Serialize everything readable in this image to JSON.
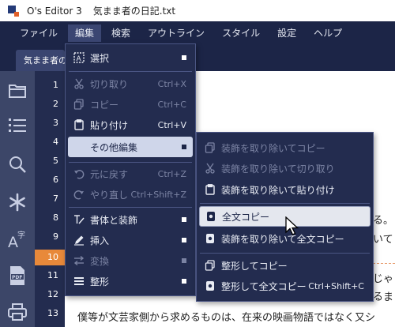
{
  "window": {
    "app_title": "O's Editor 3",
    "doc_title": "気まま者の日記.txt"
  },
  "menubar": [
    "ファイル",
    "編集",
    "検索",
    "アウトライン",
    "スタイル",
    "設定",
    "ヘルプ"
  ],
  "tab": {
    "label": "気まま者の日記.txt"
  },
  "sidebar_icons": [
    "folder-icon",
    "list-icon",
    "search-icon",
    "asterisk-icon",
    "text-size-icon",
    "pdf-icon",
    "print-icon"
  ],
  "gutter": {
    "line_numbers": [
      "1",
      "2",
      "3",
      "4",
      "5",
      "6",
      "7",
      "8",
      "9",
      "10",
      "11",
      "12",
      "13"
    ],
    "current_line": "10"
  },
  "editor": {
    "fragments": [
      "る。",
      "いて",
      "じゃ",
      "るま",
      "僕等が文芸家側から求めるものは、在来の映画物語ではなく又シ"
    ]
  },
  "edit_menu": {
    "items": [
      {
        "icon": "select-icon",
        "label": "選択",
        "shortcut": "",
        "submenu": true,
        "disabled": false
      },
      {
        "icon": "cut-icon",
        "label": "切り取り",
        "shortcut": "Ctrl+X",
        "submenu": false,
        "disabled": true
      },
      {
        "icon": "copy-icon",
        "label": "コピー",
        "shortcut": "Ctrl+C",
        "submenu": false,
        "disabled": true
      },
      {
        "icon": "paste-icon",
        "label": "貼り付け",
        "shortcut": "Ctrl+V",
        "submenu": false,
        "disabled": false
      },
      {
        "icon": "",
        "label": "その他編集",
        "shortcut": "",
        "submenu": true,
        "disabled": false
      },
      {
        "icon": "undo-icon",
        "label": "元に戻す",
        "shortcut": "Ctrl+Z",
        "submenu": false,
        "disabled": true
      },
      {
        "icon": "redo-icon",
        "label": "やり直し",
        "shortcut": "Ctrl+Shift+Z",
        "submenu": false,
        "disabled": true
      },
      {
        "icon": "format-icon",
        "label": "書体と装飾",
        "shortcut": "",
        "submenu": true,
        "disabled": false
      },
      {
        "icon": "insert-icon",
        "label": "挿入",
        "shortcut": "",
        "submenu": true,
        "disabled": false
      },
      {
        "icon": "convert-icon",
        "label": "変換",
        "shortcut": "",
        "submenu": true,
        "disabled": true
      },
      {
        "icon": "shaping-icon",
        "label": "整形",
        "shortcut": "",
        "submenu": true,
        "disabled": false
      }
    ]
  },
  "sub_menu": {
    "items": [
      {
        "icon": "copy-icon",
        "label": "装飾を取り除いてコピー",
        "shortcut": "",
        "disabled": true
      },
      {
        "icon": "cut-icon",
        "label": "装飾を取り除いて切り取り",
        "shortcut": "",
        "disabled": true
      },
      {
        "icon": "paste-icon",
        "label": "装飾を取り除いて貼り付け",
        "shortcut": "",
        "disabled": false
      },
      {
        "icon": "copy-all-icon",
        "label": "全文コピー",
        "shortcut": "",
        "disabled": false
      },
      {
        "icon": "copy-all-icon",
        "label": "装飾を取り除いて全文コピー",
        "shortcut": "",
        "disabled": false
      },
      {
        "icon": "copy-icon",
        "label": "整形してコピー",
        "shortcut": "",
        "disabled": false
      },
      {
        "icon": "copy-all-icon",
        "label": "整形して全文コピー",
        "shortcut": "Ctrl+Shift+C",
        "disabled": false
      }
    ]
  },
  "colors": {
    "menubar_bg": "#1c2547",
    "menu_bg": "#232c4f",
    "sidebar_bg": "#3c4668",
    "current_line": "#e8893a",
    "highlight": "#cfd6ea"
  }
}
